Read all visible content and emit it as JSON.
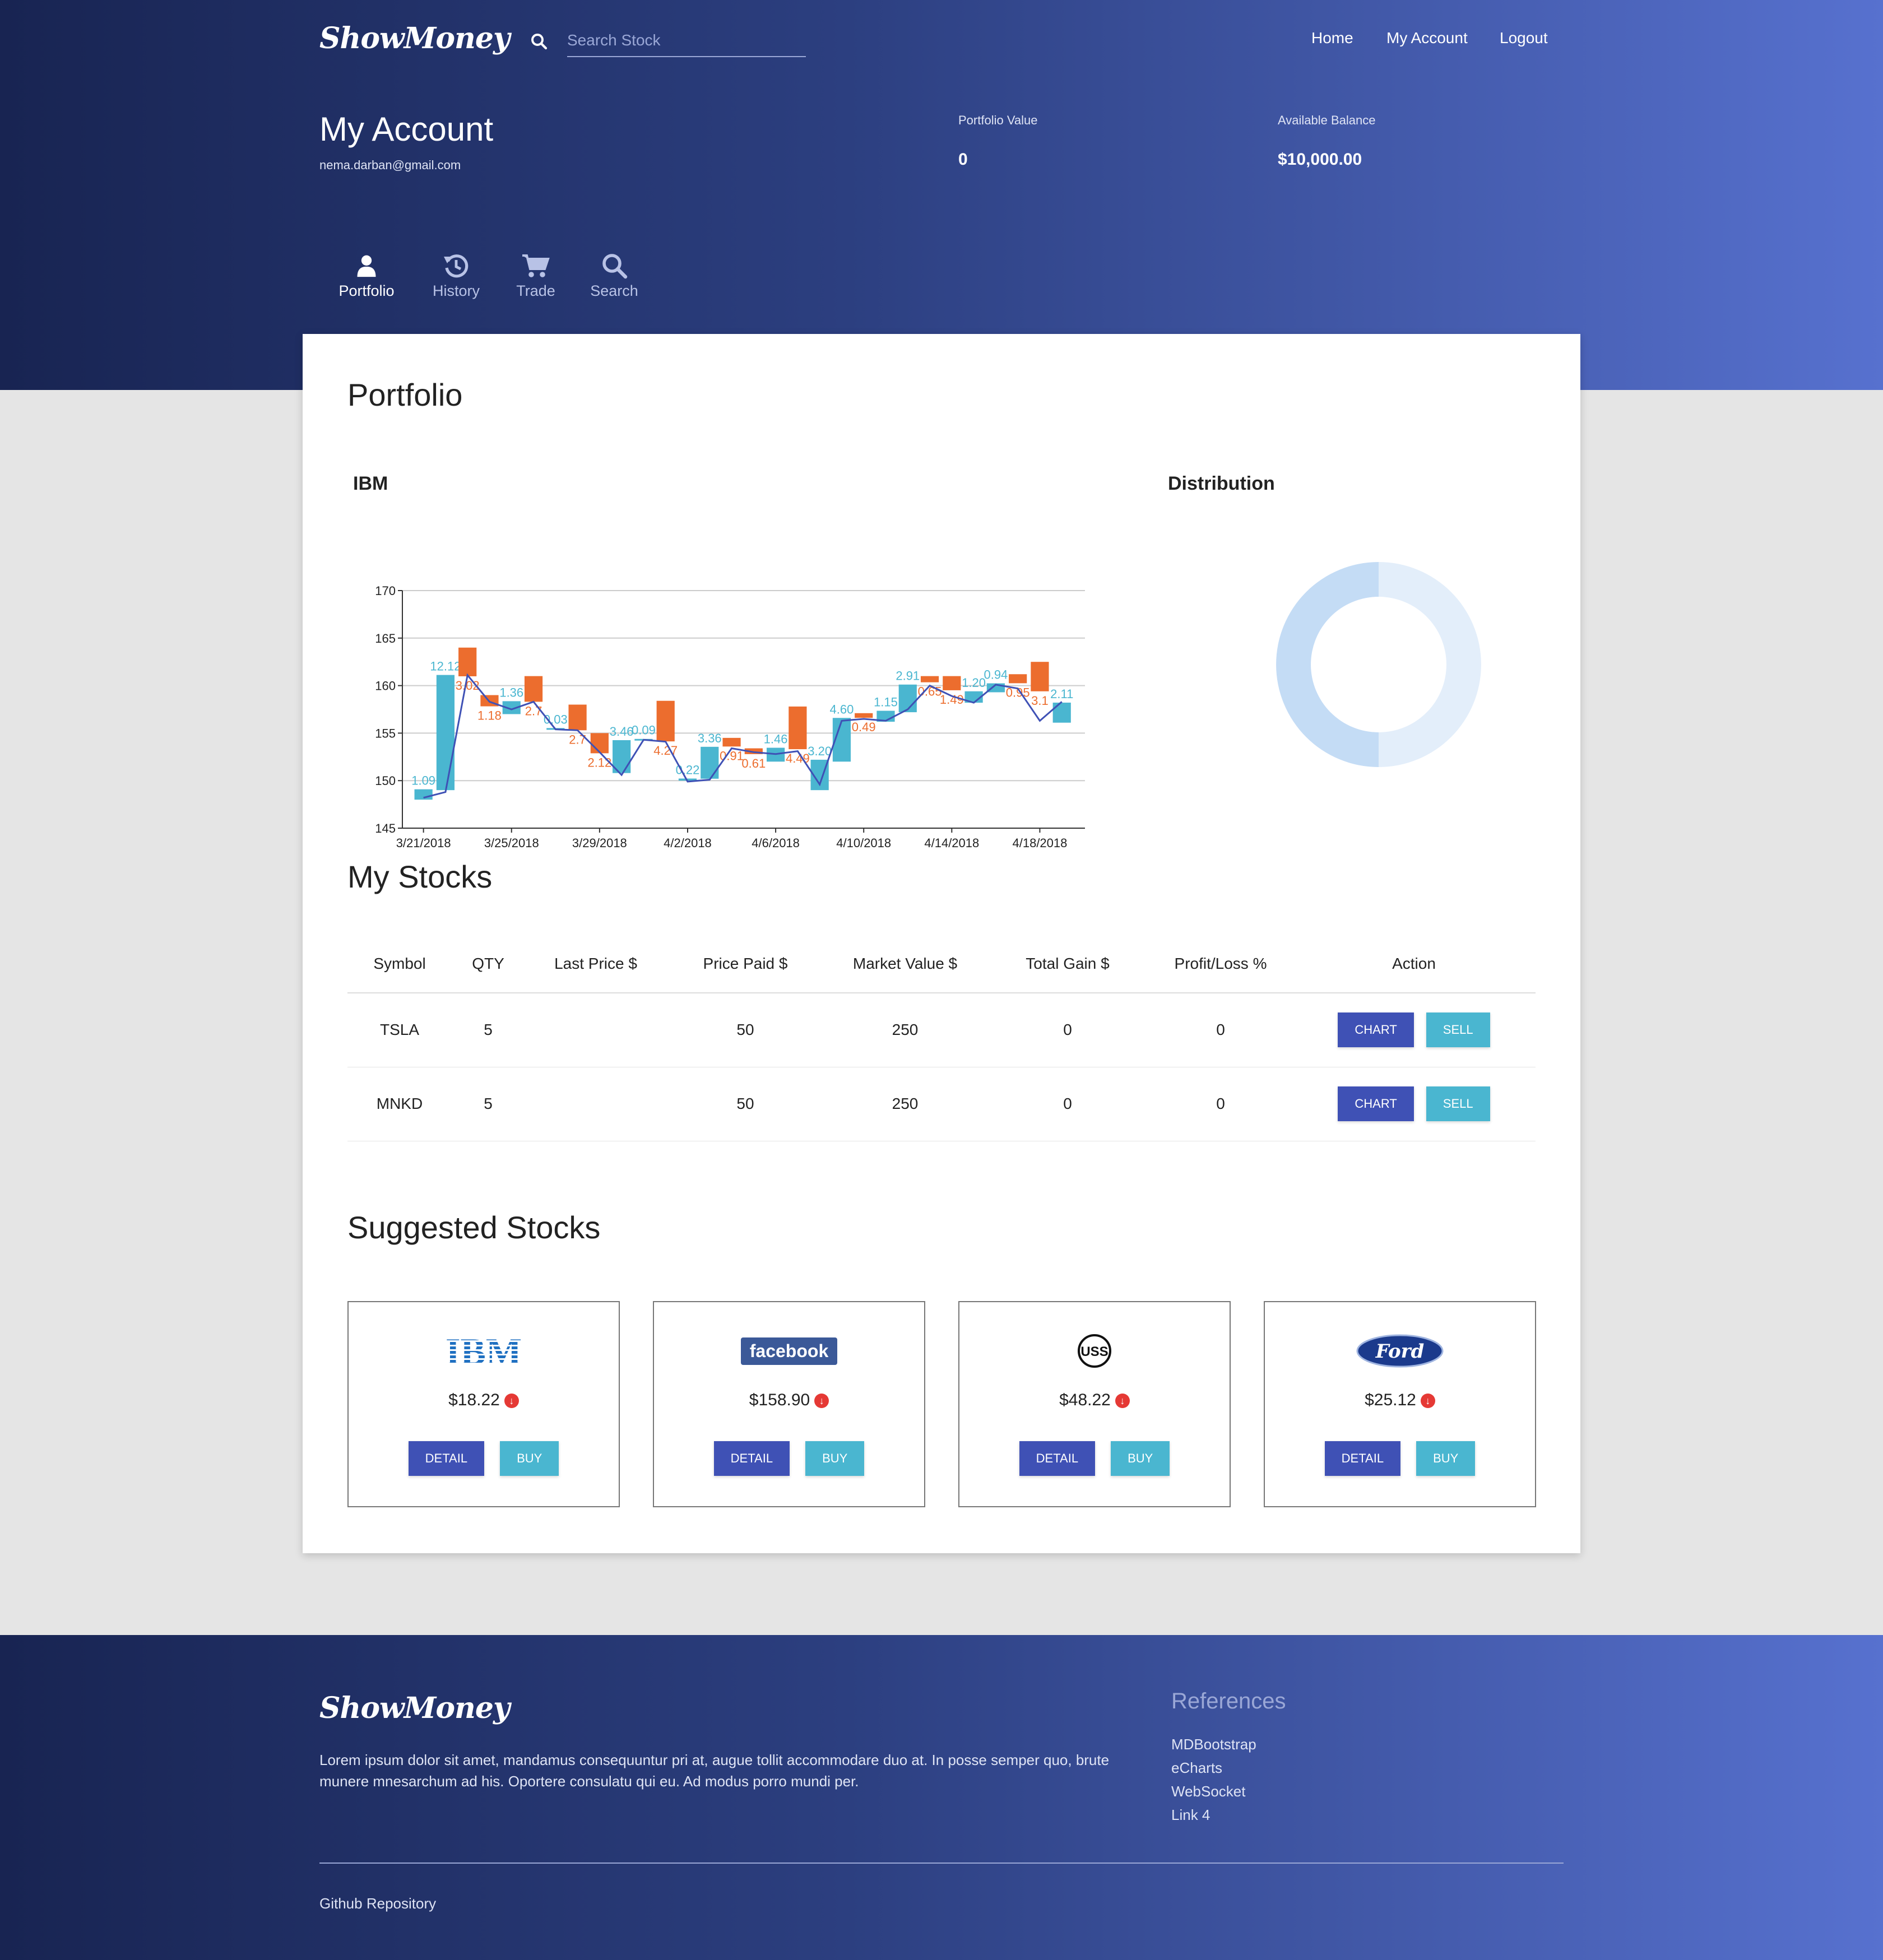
{
  "brand": "ShowMoney",
  "search": {
    "placeholder": "Search Stock"
  },
  "nav": [
    "Home",
    "My Account",
    "Logout"
  ],
  "account": {
    "title": "My Account",
    "email": "nema.darban@gmail.com",
    "portfolio_value_label": "Portfolio Value",
    "portfolio_value": "0",
    "balance_label": "Available Balance",
    "balance": "$10,000.00"
  },
  "tabs": [
    {
      "label": "Portfolio",
      "icon": "user-icon",
      "active": true
    },
    {
      "label": "History",
      "icon": "history-icon",
      "active": false
    },
    {
      "label": "Trade",
      "icon": "cart-icon",
      "active": false
    },
    {
      "label": "Search",
      "icon": "search-icon",
      "active": false
    }
  ],
  "portfolio": {
    "heading": "Portfolio",
    "chart_heading": "IBM",
    "distribution_heading": "Distribution"
  },
  "chart_data": [
    {
      "type": "bar",
      "subtype": "waterfall-with-line",
      "title": "IBM",
      "ylim": [
        145,
        170
      ],
      "yticks": [
        "145",
        "150",
        "155",
        "160",
        "165",
        "170"
      ],
      "xticks": [
        "3/21/2018",
        "3/25/2018",
        "3/29/2018",
        "4/2/2018",
        "4/6/2018",
        "4/10/2018",
        "4/14/2018",
        "4/18/2018"
      ],
      "x_start": "2018-03-21",
      "grid": true,
      "series": [
        {
          "type": "bar",
          "values": [
            {
              "date": "2018-03-21",
              "open": 148,
              "close": 149.09,
              "label": "1.09"
            },
            {
              "date": "2018-03-22",
              "open": 149,
              "close": 161.12,
              "label": "12.12"
            },
            {
              "date": "2018-03-23",
              "open": 164,
              "close": 160.98,
              "label": "3.02"
            },
            {
              "date": "2018-03-24",
              "open": 159,
              "close": 157.82,
              "label": "1.18"
            },
            {
              "date": "2018-03-25",
              "open": 157,
              "close": 158.36,
              "label": "1.36"
            },
            {
              "date": "2018-03-26",
              "open": 161,
              "close": 158.3,
              "label": "2.7"
            },
            {
              "date": "2018-03-27",
              "open": 155.5,
              "close": 155.53,
              "label": "0.03"
            },
            {
              "date": "2018-03-28",
              "open": 158,
              "close": 155.3,
              "label": "2.7"
            },
            {
              "date": "2018-03-29",
              "open": 155,
              "close": 152.88,
              "label": "2.12"
            },
            {
              "date": "2018-03-30",
              "open": 150.8,
              "close": 154.26,
              "label": "3.46"
            },
            {
              "date": "2018-03-31",
              "open": 154.3,
              "close": 154.39,
              "label": "0.09"
            },
            {
              "date": "2018-04-01",
              "open": 158.4,
              "close": 154.13,
              "label": "4.27"
            },
            {
              "date": "2018-04-02",
              "open": 150,
              "close": 150.22,
              "label": "0.22"
            },
            {
              "date": "2018-04-03",
              "open": 150.2,
              "close": 153.56,
              "label": "3.36"
            },
            {
              "date": "2018-04-04",
              "open": 154.5,
              "close": 153.59,
              "label": "0.91"
            },
            {
              "date": "2018-04-05",
              "open": 153.4,
              "close": 152.79,
              "label": "0.61"
            },
            {
              "date": "2018-04-06",
              "open": 152,
              "close": 153.46,
              "label": "1.46"
            },
            {
              "date": "2018-04-07",
              "open": 157.8,
              "close": 153.31,
              "label": "4.49"
            },
            {
              "date": "2018-04-08",
              "open": 149,
              "close": 152.2,
              "label": "3.20"
            },
            {
              "date": "2018-04-09",
              "open": 152,
              "close": 156.6,
              "label": "4.60"
            },
            {
              "date": "2018-04-10",
              "open": 157.1,
              "close": 156.61,
              "label": "0.49"
            },
            {
              "date": "2018-04-11",
              "open": 156.2,
              "close": 157.35,
              "label": "1.15"
            },
            {
              "date": "2018-04-12",
              "open": 157.2,
              "close": 160.11,
              "label": "2.91"
            },
            {
              "date": "2018-04-13",
              "open": 161.0,
              "close": 160.35,
              "label": "0.65"
            },
            {
              "date": "2018-04-14",
              "open": 161.0,
              "close": 159.51,
              "label": "1.49"
            },
            {
              "date": "2018-04-15",
              "open": 158.2,
              "close": 159.4,
              "label": "1.20"
            },
            {
              "date": "2018-04-16",
              "open": 159.3,
              "close": 160.24,
              "label": "0.94"
            },
            {
              "date": "2018-04-17",
              "open": 161.2,
              "close": 160.25,
              "label": "0.95"
            },
            {
              "date": "2018-04-18",
              "open": 162.5,
              "close": 159.4,
              "label": "3.1"
            },
            {
              "date": "2018-04-19",
              "open": 156.1,
              "close": 158.21,
              "label": "2.11"
            }
          ]
        },
        {
          "type": "line",
          "values": [
            148.2,
            148.8,
            161.1,
            158.3,
            157.5,
            158.3,
            155.4,
            155.3,
            153.0,
            150.6,
            154.3,
            154.1,
            149.9,
            150.1,
            153.4,
            153.0,
            152.8,
            153.1,
            149.6,
            156.3,
            156.5,
            156.3,
            157.5,
            160.0,
            158.9,
            158.2,
            160.1,
            159.7,
            156.3,
            158.3
          ]
        }
      ],
      "colors": {
        "up": "#4ab6d0",
        "down": "#ec6d2e",
        "line": "#3f51b5"
      }
    },
    {
      "type": "pie",
      "title": "Distribution",
      "subtype": "donut",
      "values": [
        50,
        50
      ],
      "colors": [
        "#e3eefa",
        "#c4dcf5"
      ]
    }
  ],
  "my_stocks": {
    "heading": "My Stocks",
    "columns": [
      "Symbol",
      "QTY",
      "Last Price $",
      "Price Paid $",
      "Market Value $",
      "Total Gain $",
      "Profit/Loss %",
      "Action"
    ],
    "rows": [
      {
        "symbol": "TSLA",
        "qty": "5",
        "last_price": "",
        "price_paid": "50",
        "market_value": "250",
        "total_gain": "0",
        "profit_loss": "0",
        "chart": "CHART",
        "sell": "SELL"
      },
      {
        "symbol": "MNKD",
        "qty": "5",
        "last_price": "",
        "price_paid": "50",
        "market_value": "250",
        "total_gain": "0",
        "profit_loss": "0",
        "chart": "CHART",
        "sell": "SELL"
      }
    ]
  },
  "suggested": {
    "heading": "Suggested Stocks",
    "cards": [
      {
        "logo": "IBM",
        "logo_icon": "ibm-logo",
        "price": "$18.22",
        "trend": "down",
        "detail": "DETAIL",
        "buy": "BUY"
      },
      {
        "logo": "facebook",
        "logo_icon": "facebook-logo",
        "price": "$158.90",
        "trend": "down",
        "detail": "DETAIL",
        "buy": "BUY"
      },
      {
        "logo": "USS",
        "logo_icon": "us-steel-logo",
        "price": "$48.22",
        "trend": "down",
        "detail": "DETAIL",
        "buy": "BUY"
      },
      {
        "logo": "Ford",
        "logo_icon": "ford-logo",
        "price": "$25.12",
        "trend": "down",
        "detail": "DETAIL",
        "buy": "BUY"
      }
    ]
  },
  "footer": {
    "brand": "ShowMoney",
    "text": "Lorem ipsum dolor sit amet, mandamus consequuntur pri at, augue tollit accommodare duo at. In posse semper quo, brute munere mnesarchum ad his. Oportere consulatu qui eu. Ad modus porro mundi per.",
    "references_title": "References",
    "references": [
      "MDBootstrap",
      "eCharts",
      "WebSocket",
      "Link 4"
    ],
    "github": "Github Repository"
  },
  "colors": {
    "primary": "#3f51b5",
    "info": "#4ab6d0",
    "down": "#e53935"
  }
}
